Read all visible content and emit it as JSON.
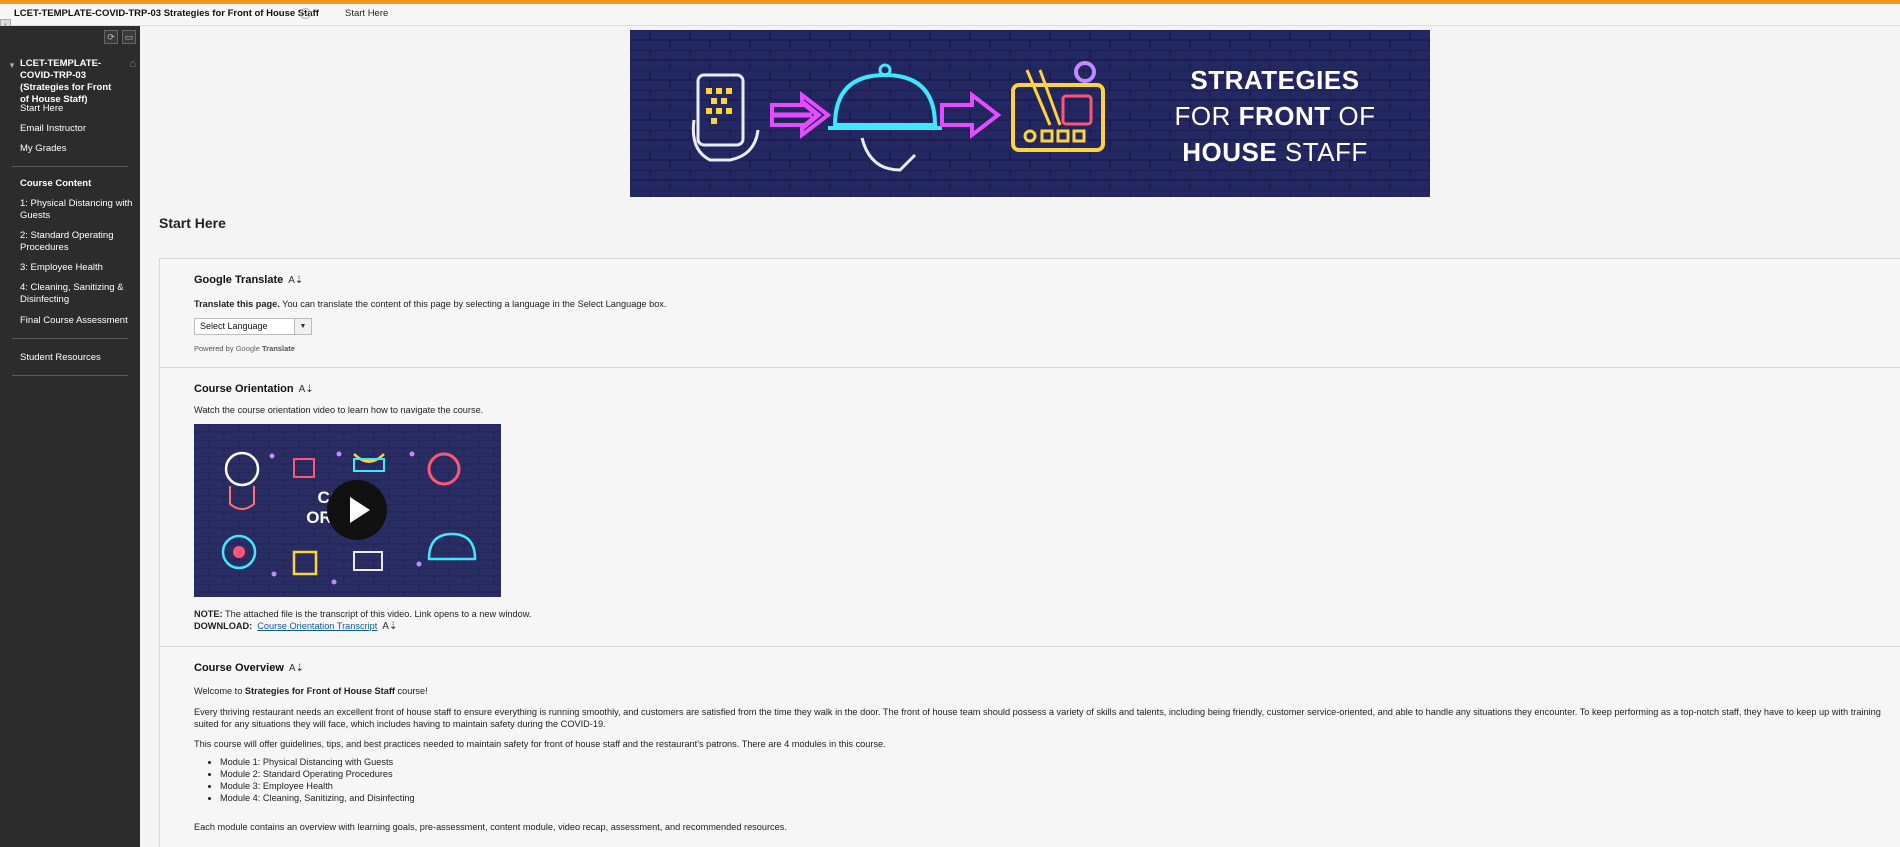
{
  "topbar": {
    "course_title": "LCET-TEMPLATE-COVID-TRP-03 Strategies for Front of House Staff",
    "current_page": "Start Here"
  },
  "sidebar": {
    "course_title": "LCET-TEMPLATE-COVID-TRP-03 (Strategies for Front of House Staff)",
    "links": [
      "Start Here",
      "Email Instructor",
      "My Grades"
    ],
    "content_heading": "Course Content",
    "modules": [
      "1: Physical Distancing with Guests",
      "2: Standard Operating Procedures",
      "3: Employee Health",
      "4: Cleaning, Sanitizing & Disinfecting",
      "Final Course Assessment"
    ],
    "resources": "Student Resources"
  },
  "banner": {
    "line1": "STRATEGIES",
    "line2_pre": "FOR ",
    "line2_bold": "FRONT",
    "line2_post": " OF",
    "line3_bold": "HOUSE",
    "line3_post": " STAFF"
  },
  "page_title": "Start Here",
  "translate": {
    "title": "Google Translate",
    "lead_bold": "Translate this page.",
    "lead_text": " You can translate the content of this page by selecting a language in the Select Language box.",
    "select_value": "Select Language",
    "powered_by": "Powered by ",
    "google": "Google",
    "translate_word": "Translate"
  },
  "orientation": {
    "title": "Course Orientation",
    "description": "Watch the course orientation video to learn how to navigate the course.",
    "video_line1": "CO  SE",
    "video_line2": "ORI    TION",
    "note_label": "NOTE:",
    "note_text": " The attached file is the transcript of this video. Link opens to a new window.",
    "download_label": "DOWNLOAD:",
    "download_link": "Course Orientation Transcript"
  },
  "overview": {
    "title": "Course Overview",
    "welcome_pre": "Welcome to ",
    "welcome_bold": "Strategies for Front of House Staff",
    "welcome_post": " course!",
    "para1": "Every thriving restaurant needs an excellent front of house staff to ensure everything is running smoothly, and customers are satisfied from the time they walk in the door. The front of house team should possess a variety of skills and talents, including being friendly, customer service-oriented, and able to handle any situations they encounter. To keep performing as a top-notch staff, they have to keep up with training suited for any situations they will face, which includes having to maintain safety during the COVID-19.",
    "para2": "This course will offer guidelines, tips, and best practices needed to maintain safety for front of house staff and the restaurant's patrons. There are 4  modules in this course.",
    "modules": [
      "Module 1: Physical Distancing with Guests",
      "Module 2: Standard Operating Procedures",
      "Module 3: Employee Health",
      "Module 4: Cleaning, Sanitizing, and Disinfecting"
    ],
    "para3": "Each module contains an overview with learning goals,  pre-assessment, content module, video recap,  assessment, and recommended resources."
  },
  "colors": {
    "accent": "#f5961f",
    "sidebar_bg": "#2c2c2c",
    "banner_bg": "#24285e",
    "link": "#0b5f9e"
  }
}
